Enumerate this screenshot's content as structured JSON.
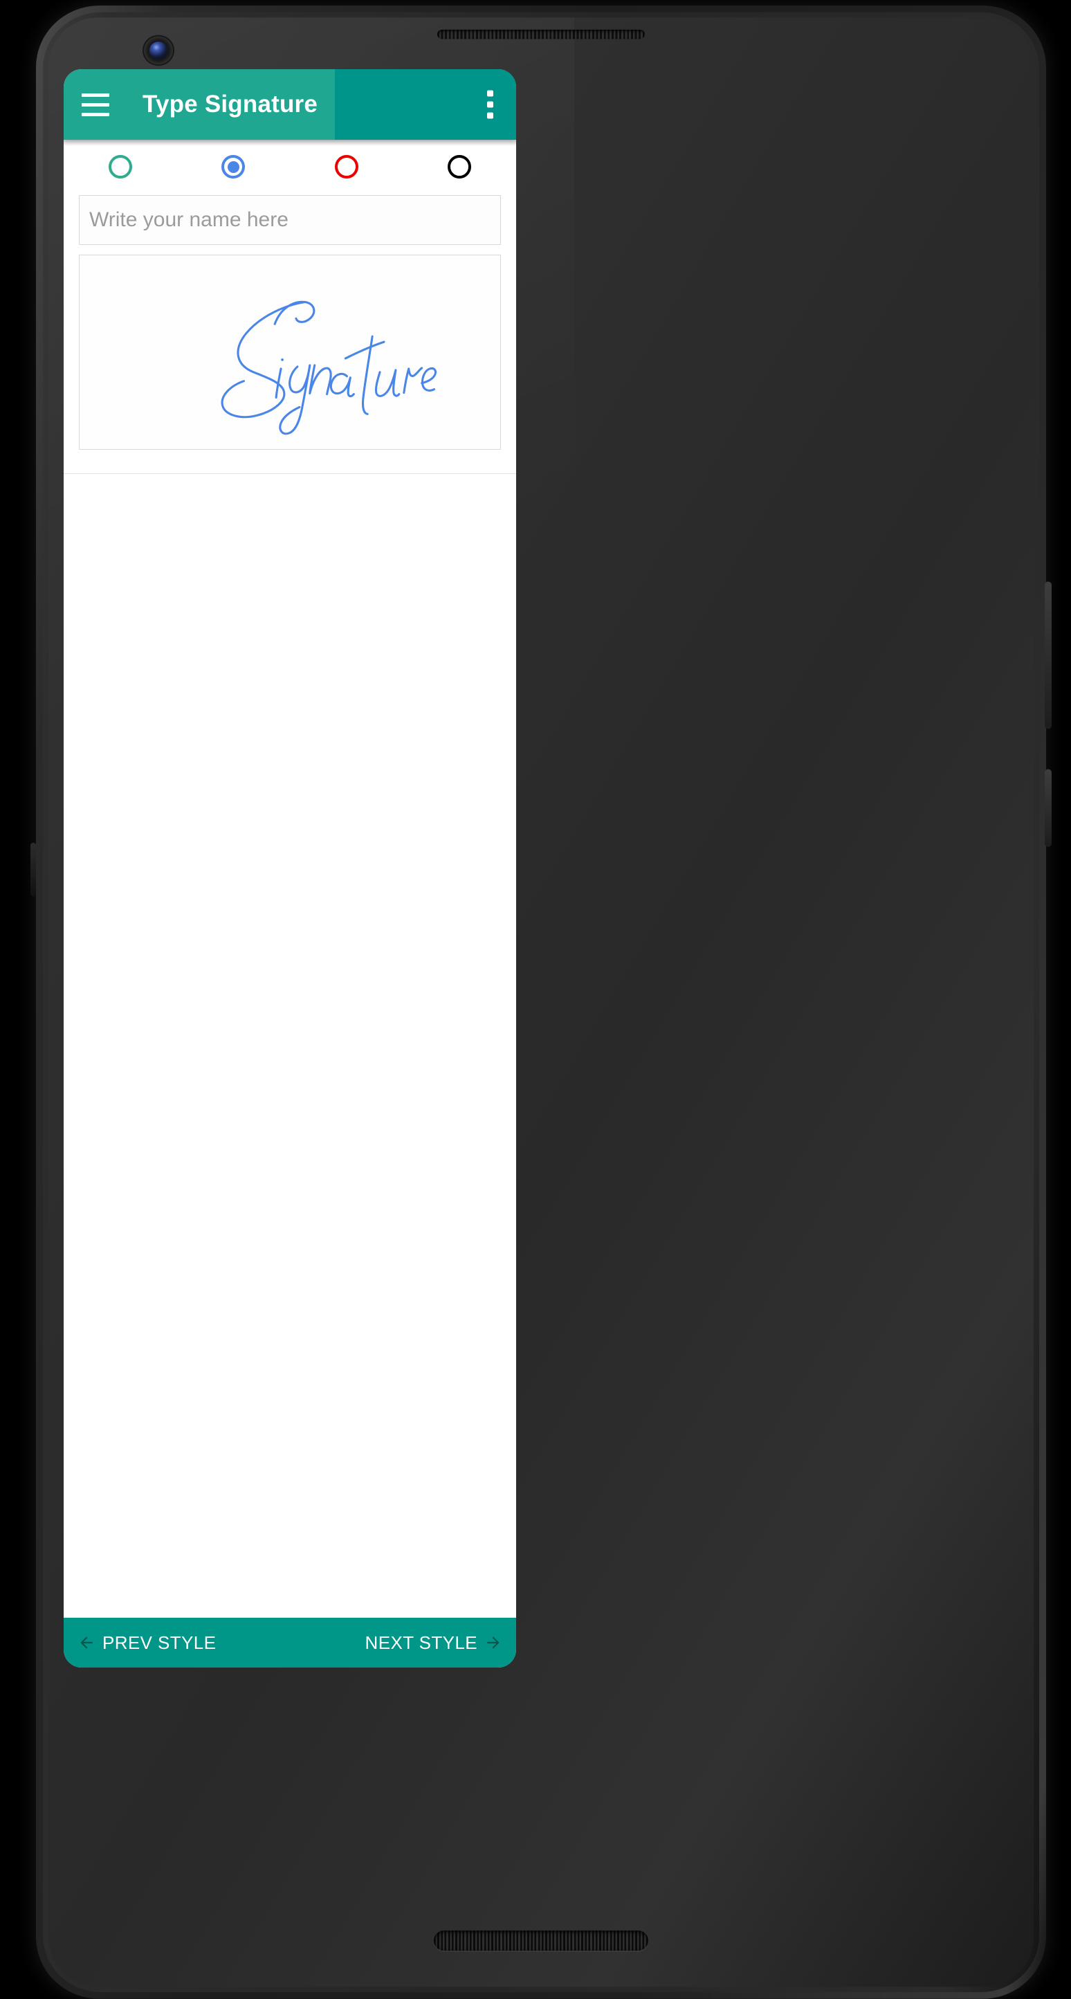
{
  "app": {
    "title": "Type Signature",
    "menu_icon": "hamburger-menu-icon",
    "overflow_icon": "more-vert-icon",
    "accent_color": "#1fa792",
    "accent_color_dark": "#009688"
  },
  "color_picker": {
    "label": "signature color radio group",
    "selected_index": 1,
    "options": [
      {
        "name": "green",
        "color": "#2fab8d",
        "selected": false
      },
      {
        "name": "blue",
        "color": "#4a86e8",
        "selected": true
      },
      {
        "name": "red",
        "color": "#ee0000",
        "selected": false
      },
      {
        "name": "black",
        "color": "#000000",
        "selected": false
      }
    ]
  },
  "name_input": {
    "placeholder": "Write your name here",
    "value": ""
  },
  "signature_preview": {
    "text": "Signature",
    "ink_color": "#4a86e8",
    "style": "handwritten-script"
  },
  "bottom_bar": {
    "prev_label": "PREV STYLE",
    "next_label": "NEXT STYLE",
    "prev_icon": "arrow-left-icon",
    "next_icon": "arrow-right-icon",
    "arrow_color": "#05564f"
  }
}
